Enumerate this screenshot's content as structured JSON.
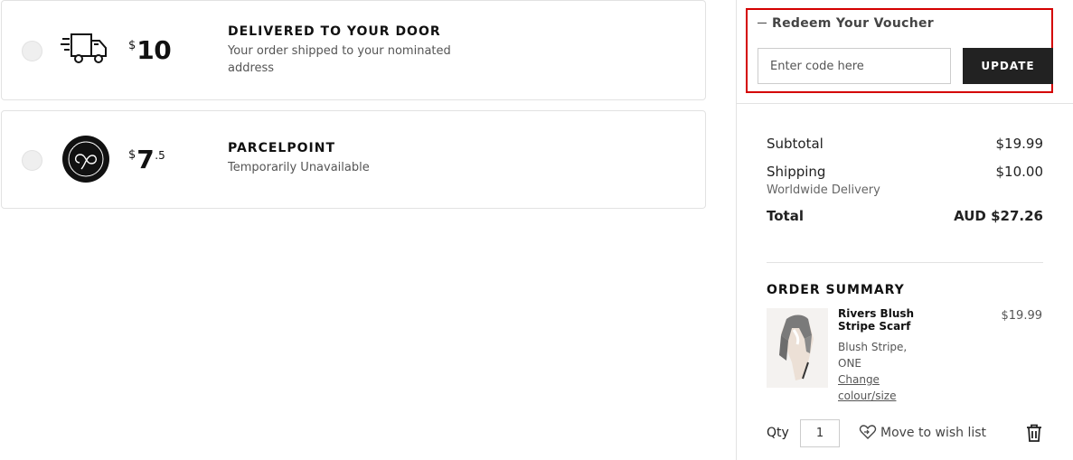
{
  "shipping_options": [
    {
      "currency": "$",
      "amount": "10",
      "decimal": "",
      "title": "DELIVERED TO YOUR DOOR",
      "subtitle": "Your order shipped to your nominated address",
      "icon": "delivery-truck-icon"
    },
    {
      "currency": "$",
      "amount": "7",
      "decimal": ".5",
      "title": "PARCELPOINT",
      "subtitle": "Temporarily Unavailable",
      "icon": "parcelpoint-logo"
    }
  ],
  "voucher": {
    "title": "Redeem Your Voucher",
    "placeholder": "Enter code here",
    "update_label": "UPDATE"
  },
  "totals": {
    "subtotal_label": "Subtotal",
    "subtotal_value": "$19.99",
    "shipping_label": "Shipping",
    "shipping_value": "$10.00",
    "shipping_note": "Worldwide Delivery",
    "total_label": "Total",
    "total_value": "AUD $27.26"
  },
  "order_summary": {
    "title": "ORDER SUMMARY",
    "item": {
      "name": "Rivers Blush Stripe Scarf",
      "price": "$19.99",
      "variant_line1": "Blush Stripe,",
      "variant_line2": "ONE",
      "change_line1": "Change",
      "change_line2": "colour/size"
    },
    "qty_label": "Qty",
    "qty_value": "1",
    "wishlist_label": "Move to wish list"
  },
  "colors": {
    "highlight": "#d40000",
    "button_bg": "#222222"
  }
}
